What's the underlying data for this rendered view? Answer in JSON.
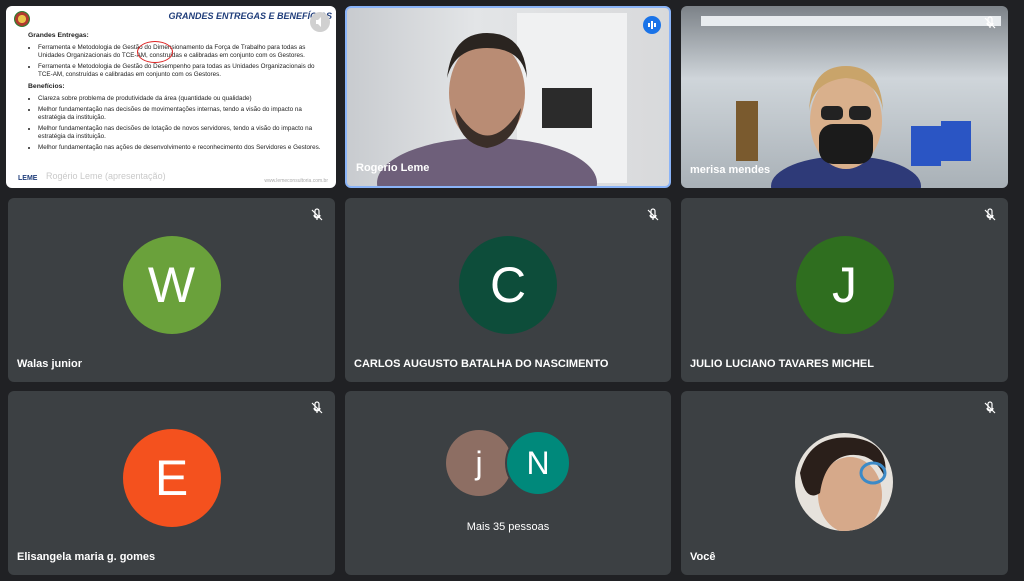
{
  "slide": {
    "title": "GRANDES ENTREGAS E BENEFÍCIOS",
    "section1": "Grandes Entregas:",
    "bullets1": [
      "Ferramenta e Metodologia de Gestão do Dimensionamento da Força de Trabalho para todas as Unidades Organizacionais do TCE-AM, construídas e calibradas em conjunto com os Gestores.",
      "Ferramenta e Metodologia de Gestão do Desempenho para todas as Unidades Organizacionais do TCE-AM, construídas e calibradas em conjunto com os Gestores."
    ],
    "section2": "Benefícios:",
    "bullets2": [
      "Clareza sobre problema de produtividade da área (quantidade ou qualidade)",
      "Melhor fundamentação nas decisões de movimentações internas, tendo a visão do impacto na estratégia da instituição.",
      "Melhor fundamentação nas decisões de lotação de novos servidores, tendo a visão do impacto na estratégia da instituição.",
      "Melhor fundamentação nas ações de desenvolvimento e reconhecimento dos Servidores e Gestores."
    ],
    "presenter_caption": "Rogério Leme (apresentação)",
    "logo_text": "LEME",
    "footer": "www.lemeconsultoria.com.br"
  },
  "tiles": [
    {
      "name": "Rogerio Leme"
    },
    {
      "name": "merisa mendes"
    },
    {
      "name": "Walas junior",
      "initial": "W",
      "color": "#6aa13b"
    },
    {
      "name": "CARLOS AUGUSTO BATALHA DO NASCIMENTO",
      "initial": "C",
      "color": "#0d4d3a"
    },
    {
      "name": "JULIO LUCIANO TAVARES MICHEL",
      "initial": "J",
      "color": "#2f6e1f"
    },
    {
      "name": "Elisangela maria g. gomes",
      "initial": "E",
      "color": "#f4511e"
    },
    {
      "name": "Você"
    }
  ],
  "group": {
    "initials": [
      "j",
      "N"
    ],
    "colors": [
      "#8d6e63",
      "#00897b"
    ],
    "label": "Mais 35 pessoas"
  },
  "colors": {
    "background": "#202124",
    "tile": "#3c4043",
    "speaking": "#1a73e8",
    "active_border": "#8ab4f8"
  },
  "icons": {
    "mic_off": "mic-off-icon",
    "speaking": "audio-wave-icon"
  }
}
